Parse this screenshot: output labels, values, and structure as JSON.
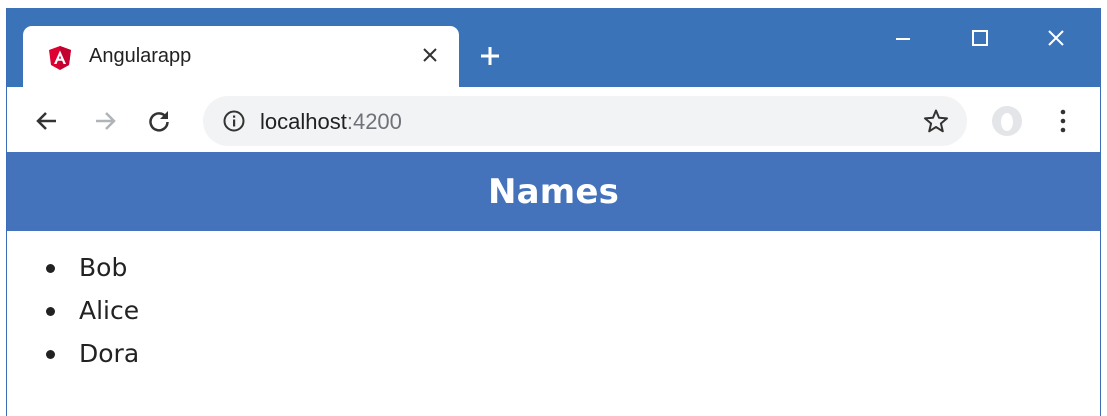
{
  "browser": {
    "tab": {
      "title": "Angularapp",
      "favicon": "angular-icon"
    },
    "new_tab_icon": "plus-icon",
    "window_controls": [
      "minimize-icon",
      "maximize-icon",
      "close-icon"
    ],
    "toolbar": {
      "back_icon": "back-arrow-icon",
      "forward_icon": "forward-arrow-icon",
      "reload_icon": "reload-icon",
      "url_host": "localhost",
      "url_port": ":4200",
      "bookmark_icon": "star-icon",
      "profile_icon": "profile-icon",
      "menu_icon": "kebab-menu-icon"
    },
    "colors": {
      "titlebar": "#3b73b9",
      "header": "#4472bb"
    }
  },
  "page": {
    "heading": "Names",
    "names": [
      "Bob",
      "Alice",
      "Dora"
    ]
  }
}
